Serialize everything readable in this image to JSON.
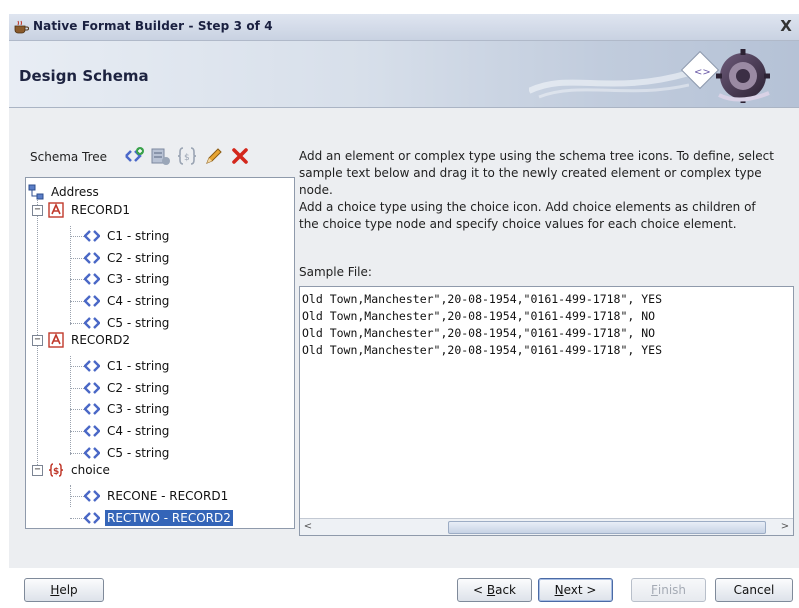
{
  "window": {
    "title": "Native Format Builder - Step 3 of 4",
    "close_glyph": "X"
  },
  "banner": {
    "step_title": "Design Schema"
  },
  "schema_tree": {
    "label": "Schema Tree",
    "toolbar_icons": [
      "add-element-icon",
      "add-complex-type-icon",
      "add-choice-icon",
      "edit-pencil-icon",
      "delete-x-icon"
    ],
    "root": "Address",
    "nodes": [
      {
        "label": "RECORD1",
        "children": [
          "C1 - string",
          "C2 - string",
          "C3 - string",
          "C4 - string",
          "C5 - string"
        ]
      },
      {
        "label": "RECORD2",
        "children": [
          "C1 - string",
          "C2 - string",
          "C3 - string",
          "C4 - string",
          "C5 - string"
        ]
      },
      {
        "label": "choice",
        "children": [
          "RECONE - RECORD1",
          "RECTWO - RECORD2"
        ]
      }
    ],
    "selected": "RECTWO - RECORD2"
  },
  "instructions": {
    "line1": "Add an element or complex type using the schema tree icons. To define, select sample text below and drag it to the newly created element or complex type node.",
    "line2": "Add a choice type using the choice icon. Add choice elements as children of the choice type node and specify choice values for each choice element."
  },
  "sample_file": {
    "label": "Sample File:",
    "lines": [
      "Old Town,Manchester\",20-08-1954,\"0161-499-1718\", YES",
      "Old Town,Manchester\",20-08-1954,\"0161-499-1718\", NO",
      "Old Town,Manchester\",20-08-1954,\"0161-499-1718\", NO",
      "Old Town,Manchester\",20-08-1954,\"0161-499-1718\", YES"
    ]
  },
  "buttons": {
    "help": {
      "pre": "",
      "mn": "H",
      "post": "elp"
    },
    "back": {
      "pre": "< ",
      "mn": "B",
      "post": "ack"
    },
    "next": {
      "pre": "",
      "mn": "N",
      "post": "ext >"
    },
    "finish": {
      "pre": "",
      "mn": "F",
      "post": "inish"
    },
    "cancel": {
      "pre": "",
      "mn": "",
      "post": "Cancel"
    }
  }
}
